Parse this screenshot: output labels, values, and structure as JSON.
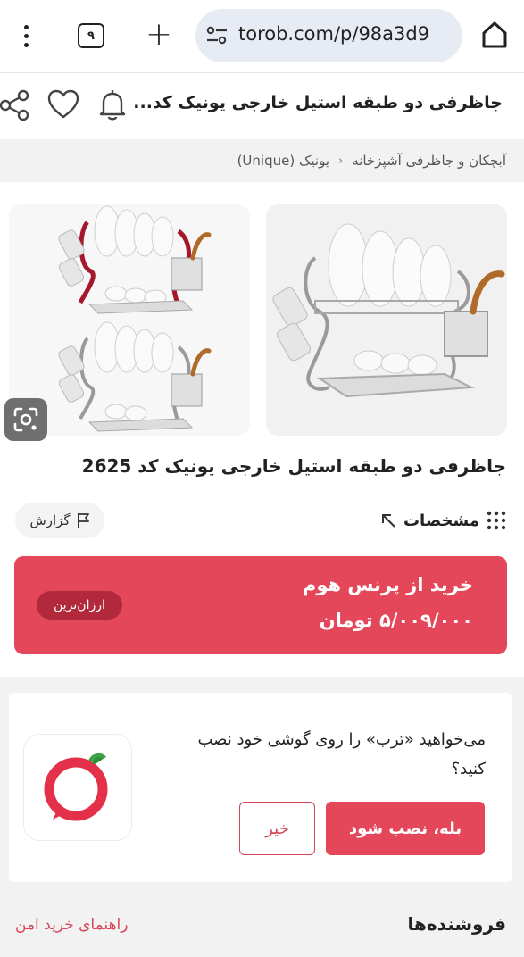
{
  "browser": {
    "tab_count": "۹",
    "url": "torob.com/p/98a3d9"
  },
  "header": {
    "title": "جاظرفی دو طبقه استیل خارجی یونیک کد..."
  },
  "breadcrumb": {
    "items": [
      "آبچکان و جاظرفی آشپزخانه",
      "یونیک (Unique)"
    ]
  },
  "product": {
    "name": "جاظرفی دو طبقه استیل خارجی یونیک کد 2625",
    "specs_label": "مشخصات",
    "report_label": "گزارش"
  },
  "offer": {
    "store": "خرید از پرنس هوم",
    "price": "۵/۰۰۹/۰۰۰ تومان",
    "badge": "ارزان‌ترین"
  },
  "install_prompt": {
    "question": "می‌خواهید «ترب» را روی گوشی خود نصب کنید؟",
    "yes_label": "بله، نصب شود",
    "no_label": "خیر"
  },
  "sellers": {
    "title": "فروشنده‌ها",
    "safe_guide": "راهنمای خرید امن"
  },
  "colors": {
    "accent": "#e5475a",
    "badge": "#b2293c"
  },
  "icons": {
    "menu": "more-vert-icon",
    "new_tab": "plus-icon",
    "site_settings": "tune-icon",
    "home": "home-icon",
    "share": "share-icon",
    "like": "heart-icon",
    "notify": "bell-icon",
    "lens": "google-lens-icon",
    "report": "flag-icon",
    "specs": "grid-dots-icon",
    "specs_arrow": "arrow-up-left-icon"
  }
}
